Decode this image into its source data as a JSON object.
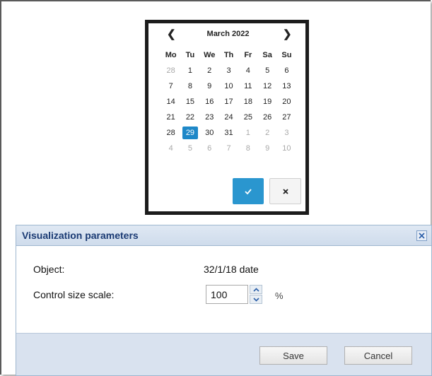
{
  "calendar": {
    "month_title": "March 2022",
    "prev_icon": "chevron-left-icon",
    "next_icon": "chevron-right-icon",
    "weekdays": [
      "Mo",
      "Tu",
      "We",
      "Th",
      "Fr",
      "Sa",
      "Su"
    ],
    "weeks": [
      [
        [
          "28",
          true
        ],
        [
          "1",
          false
        ],
        [
          "2",
          false
        ],
        [
          "3",
          false
        ],
        [
          "4",
          false
        ],
        [
          "5",
          false
        ],
        [
          "6",
          false
        ]
      ],
      [
        [
          "7",
          false
        ],
        [
          "8",
          false
        ],
        [
          "9",
          false
        ],
        [
          "10",
          false
        ],
        [
          "11",
          false
        ],
        [
          "12",
          false
        ],
        [
          "13",
          false
        ]
      ],
      [
        [
          "14",
          false
        ],
        [
          "15",
          false
        ],
        [
          "16",
          false
        ],
        [
          "17",
          false
        ],
        [
          "18",
          false
        ],
        [
          "19",
          false
        ],
        [
          "20",
          false
        ]
      ],
      [
        [
          "21",
          false
        ],
        [
          "22",
          false
        ],
        [
          "23",
          false
        ],
        [
          "24",
          false
        ],
        [
          "25",
          false
        ],
        [
          "26",
          false
        ],
        [
          "27",
          false
        ]
      ],
      [
        [
          "28",
          false
        ],
        [
          "29",
          false
        ],
        [
          "30",
          false
        ],
        [
          "31",
          false
        ],
        [
          "1",
          true
        ],
        [
          "2",
          true
        ],
        [
          "3",
          true
        ]
      ],
      [
        [
          "4",
          true
        ],
        [
          "5",
          true
        ],
        [
          "6",
          true
        ],
        [
          "7",
          true
        ],
        [
          "8",
          true
        ],
        [
          "9",
          true
        ],
        [
          "10",
          true
        ]
      ]
    ],
    "selected_day": "29",
    "confirm_icon": "check-icon",
    "cancel_icon": "close-x-icon",
    "accent_color": "#1e88c8"
  },
  "dialog": {
    "title": "Visualization parameters",
    "close_icon": "close-icon",
    "object_label": "Object:",
    "object_value": "32/1/18 date",
    "scale_label": "Control size scale:",
    "scale_value": "100",
    "scale_unit": "%",
    "save_label": "Save",
    "cancel_label": "Cancel",
    "title_color": "#1a3a73"
  }
}
